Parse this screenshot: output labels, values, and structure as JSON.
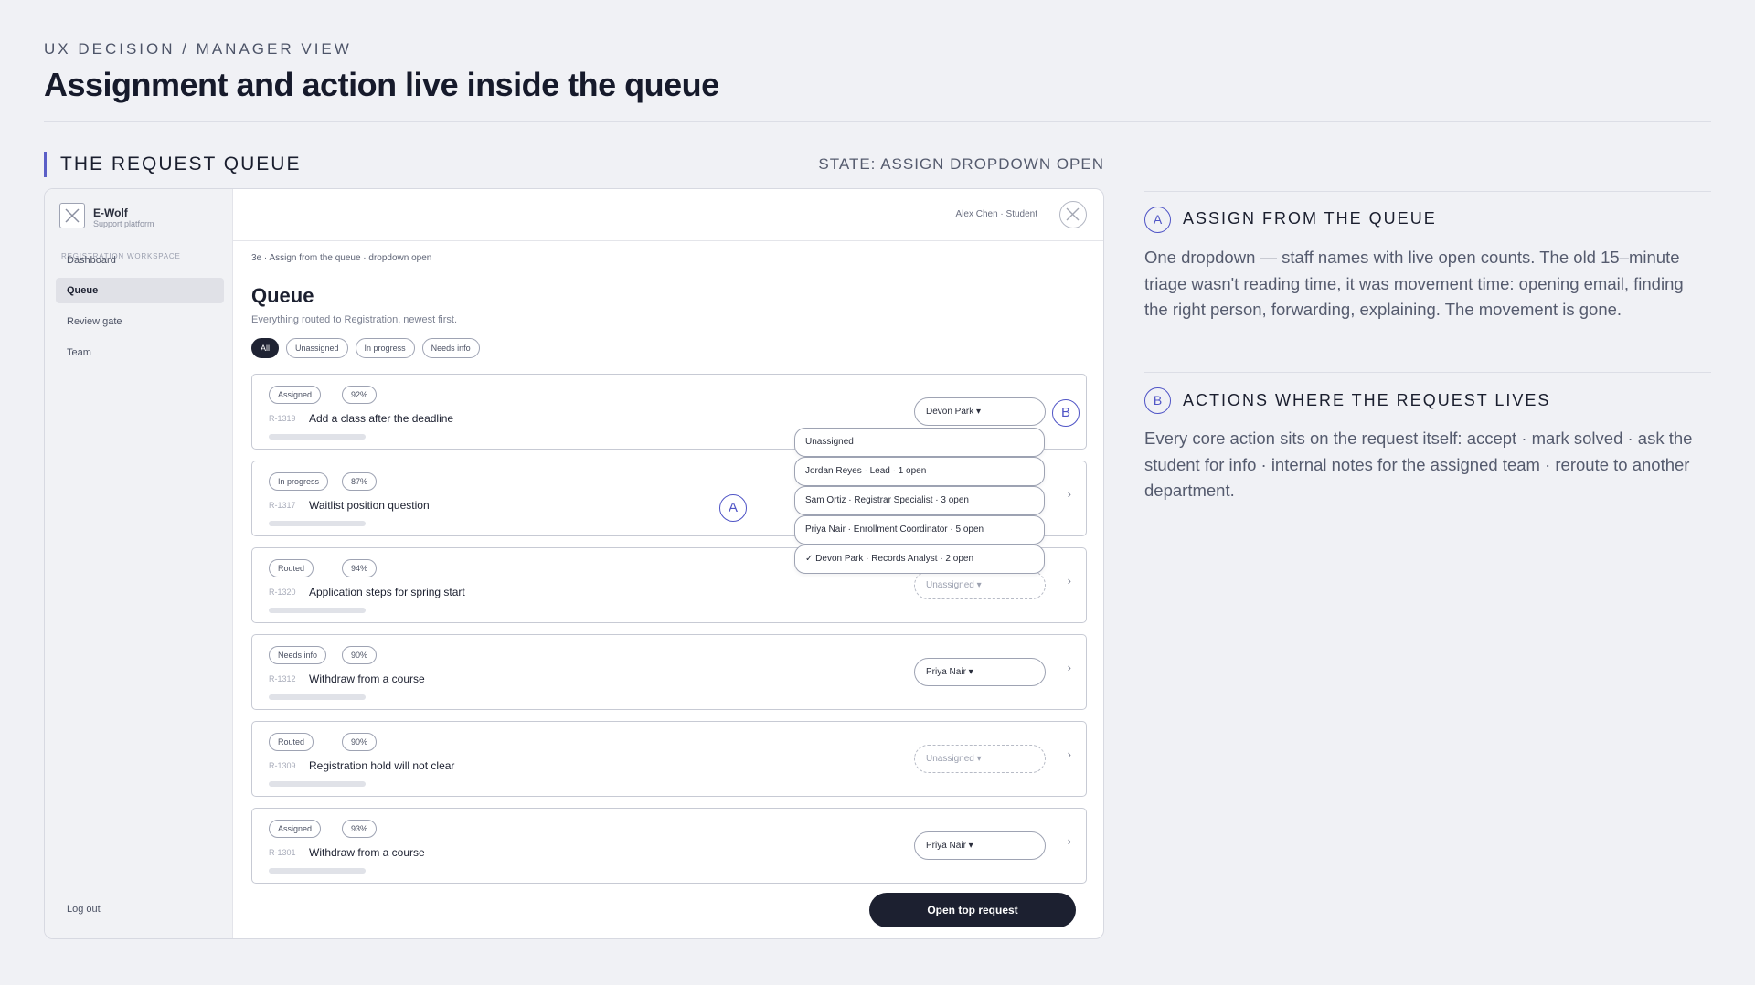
{
  "header": {
    "eyebrow": "UX DECISION / MANAGER VIEW",
    "title": "Assignment and action live inside the queue"
  },
  "section": {
    "title": "THE REQUEST QUEUE",
    "state": "STATE: ASSIGN DROPDOWN OPEN"
  },
  "app": {
    "brand": {
      "name": "E-Wolf",
      "subtitle": "Support platform"
    },
    "workspace_label": "REGISTRATION WORKSPACE",
    "nav": [
      {
        "label": "Dashboard",
        "active": false
      },
      {
        "label": "Queue",
        "active": true
      },
      {
        "label": "Review gate",
        "active": false
      },
      {
        "label": "Team",
        "active": false
      }
    ],
    "logout": "Log out",
    "user": "Alex Chen · Student",
    "step_label": "3e · Assign from the queue · dropdown open",
    "queue_title": "Queue",
    "queue_subtitle": "Everything routed to Registration, newest first.",
    "filters": [
      {
        "label": "All",
        "active": true
      },
      {
        "label": "Unassigned",
        "active": false
      },
      {
        "label": "In progress",
        "active": false
      },
      {
        "label": "Needs info",
        "active": false
      }
    ],
    "requests": [
      {
        "status": "Assigned",
        "confidence": "92%",
        "id": "R-1319",
        "title": "Add a class after the deadline",
        "assignee": "Devon Park ▾",
        "unassigned": false
      },
      {
        "status": "In progress",
        "confidence": "87%",
        "id": "R-1317",
        "title": "Waitlist position question",
        "assignee": "",
        "unassigned": false
      },
      {
        "status": "Routed",
        "confidence": "94%",
        "id": "R-1320",
        "title": "Application steps for spring start",
        "assignee": "Unassigned ▾",
        "unassigned": true
      },
      {
        "status": "Needs info",
        "confidence": "90%",
        "id": "R-1312",
        "title": "Withdraw from a course",
        "assignee": "Priya Nair ▾",
        "unassigned": false
      },
      {
        "status": "Routed",
        "confidence": "90%",
        "id": "R-1309",
        "title": "Registration hold will not clear",
        "assignee": "Unassigned ▾",
        "unassigned": true
      },
      {
        "status": "Assigned",
        "confidence": "93%",
        "id": "R-1301",
        "title": "Withdraw from a course",
        "assignee": "Priya Nair ▾",
        "unassigned": false
      }
    ],
    "dropdown_options": [
      "Unassigned",
      "Jordan Reyes · Lead · 1 open",
      "Sam Ortiz · Registrar Specialist · 3 open",
      "Priya Nair · Enrollment Coordinator · 5 open",
      "✓ Devon Park · Records Analyst · 2 open"
    ],
    "open_button": "Open top request",
    "chevron": "›"
  },
  "markers": {
    "a": "A",
    "b": "B"
  },
  "notes": [
    {
      "marker": "A",
      "title": "ASSIGN FROM THE QUEUE",
      "body": "One dropdown — staff names with live open counts. The old 15–minute triage wasn't reading time, it was movement time: opening email, finding the right person, forwarding, explaining. The movement is gone."
    },
    {
      "marker": "B",
      "title": "ACTIONS WHERE THE REQUEST LIVES",
      "body": "Every core action sits on the request itself: accept · mark solved · ask the student for info · internal notes for the assigned team · reroute to another department."
    }
  ],
  "colors": {
    "accent": "#4f54c6",
    "dark": "#1c2030",
    "background": "#f0f1f5"
  }
}
